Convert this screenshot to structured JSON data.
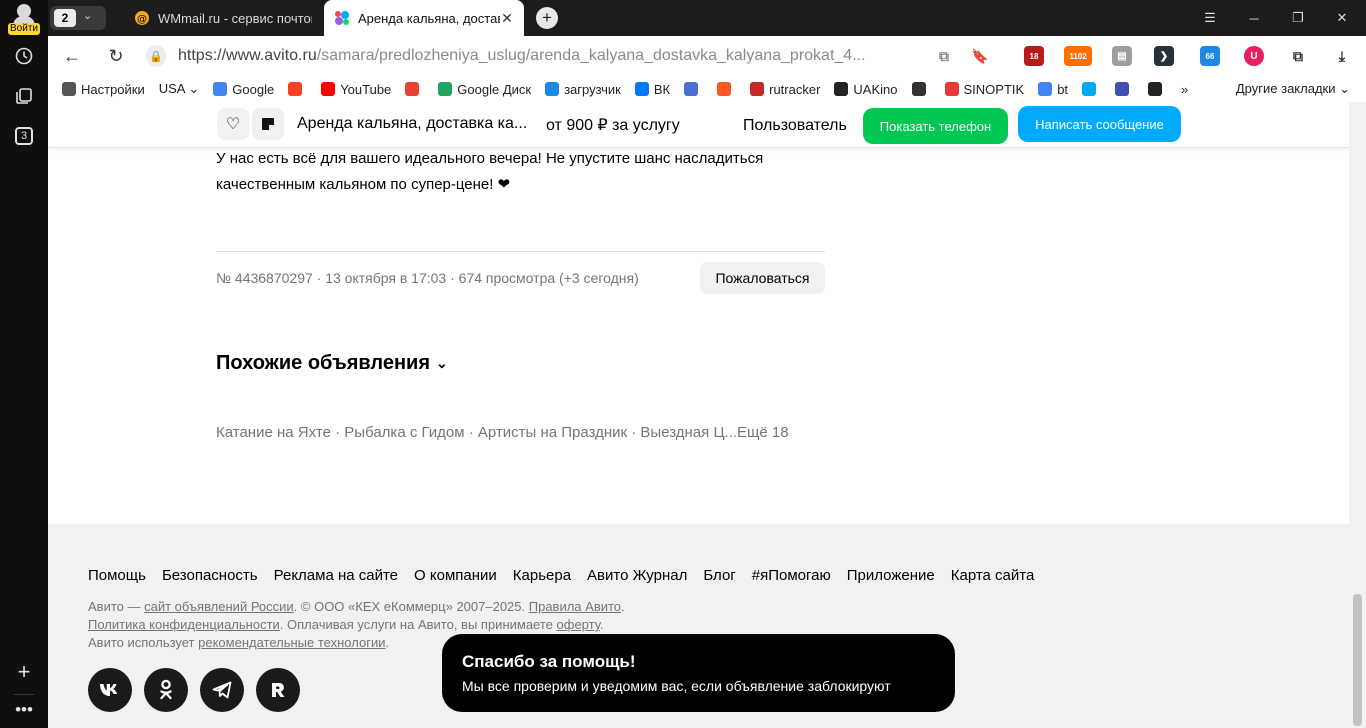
{
  "browser": {
    "sidebar": {
      "login_label": "Войти",
      "tabs_count": "3"
    },
    "tab_group_count": "2",
    "tabs": [
      {
        "title": "WMmail.ru - сервис почтовых рассылок"
      },
      {
        "title": "Аренда кальяна, доставка кальяна"
      }
    ],
    "url": {
      "host": "https://www.avito.ru",
      "path": "/samara/predlozheniya_uslug/arenda_kalyana_dostavka_kalyana_prokat_4..."
    },
    "extension_badges": {
      "first": "18",
      "second": "1102",
      "third": "66"
    },
    "bookmarks": [
      {
        "label": "Настройки",
        "color": "#555555"
      },
      {
        "label": "USA ⌄",
        "color": ""
      },
      {
        "label": "Google",
        "color": "#4285f4"
      },
      {
        "label": "",
        "color": "#fc3f1d"
      },
      {
        "label": "YouTube",
        "color": "#ff0000"
      },
      {
        "label": "",
        "color": "#ea4335"
      },
      {
        "label": "Google Диск",
        "color": "#1fa463"
      },
      {
        "label": "загрузчик",
        "color": "#1e88e5"
      },
      {
        "label": "ВК",
        "color": "#0077ff"
      },
      {
        "label": "",
        "color": "#4a6fd1"
      },
      {
        "label": "",
        "color": "#ff5722"
      },
      {
        "label": "rutracker",
        "color": "#c62828"
      },
      {
        "label": "UAKino",
        "color": "#222222"
      },
      {
        "label": "",
        "color": "#333333"
      },
      {
        "label": "SINOPTIK",
        "color": "#e53935"
      },
      {
        "label": "bt",
        "color": "#4285f4"
      },
      {
        "label": "",
        "color": "#03a9f4"
      },
      {
        "label": "",
        "color": "#3f51b5"
      },
      {
        "label": "",
        "color": "#222222"
      }
    ],
    "bookmarks_more": "»",
    "other_bookmarks": "Другие закладки"
  },
  "sticky": {
    "title": "Аренда кальяна, доставка ка...",
    "price": "от 900 ₽ за услугу",
    "seller": "Пользователь",
    "show_phone": "Показать телефон",
    "write_message": "Написать сообщение"
  },
  "listing": {
    "description_line1": "У нас есть всё для вашего идеального вечера! Не упустите шанс насладиться",
    "description_line2": "качественным кальяном по супер-цене! ❤",
    "meta": "№ 4436870297 · 13 октября в 17:03 · 674 просмотра (+3 сегодня)",
    "complain": "Пожаловаться",
    "similar_title": "Похожие объявления",
    "similar_tags": "Катание на Яхте · Рыбалка с Гидом · Артисты на Праздник · Выездная Ц...Ещё 18"
  },
  "footer": {
    "links": [
      "Помощь",
      "Безопасность",
      "Реклама на сайте",
      "О компании",
      "Карьера",
      "Авито Журнал",
      "Блог",
      "#яПомогаю",
      "Приложение",
      "Карта сайта"
    ],
    "legal": {
      "l1a": "Авито — ",
      "l1b": "сайт объявлений России",
      "l1c": ". © ООО «КЕХ еКоммерц» 2007–2025. ",
      "l1d": "Правила Авито",
      "l1e": ".",
      "l2a": "Политика конфиденциальности",
      "l2b": ". Оплачивая услуги на Авито, вы принимаете ",
      "l2c": "оферту",
      "l2d": ".",
      "l3a": "Авито использует ",
      "l3b": "рекомендательные технологии",
      "l3c": "."
    },
    "social": [
      "vk",
      "ok",
      "telegram",
      "rustore"
    ]
  },
  "toast": {
    "title": "Спасибо за помощь!",
    "text": "Мы все проверим и уведомим вас, если объявление заблокируют"
  }
}
